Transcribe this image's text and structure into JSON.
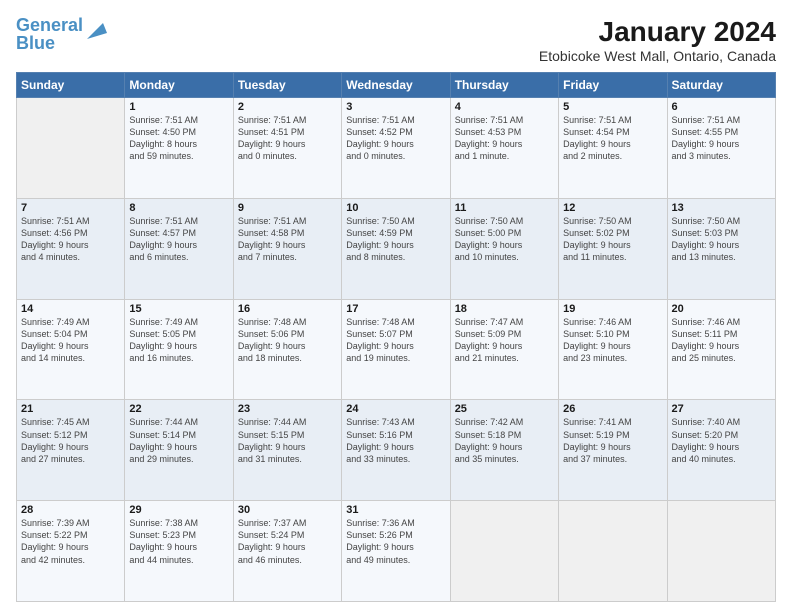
{
  "header": {
    "logo_line1": "General",
    "logo_line2": "Blue",
    "title": "January 2024",
    "subtitle": "Etobicoke West Mall, Ontario, Canada"
  },
  "weekdays": [
    "Sunday",
    "Monday",
    "Tuesday",
    "Wednesday",
    "Thursday",
    "Friday",
    "Saturday"
  ],
  "weeks": [
    [
      {
        "day": "",
        "text": ""
      },
      {
        "day": "1",
        "text": "Sunrise: 7:51 AM\nSunset: 4:50 PM\nDaylight: 8 hours\nand 59 minutes."
      },
      {
        "day": "2",
        "text": "Sunrise: 7:51 AM\nSunset: 4:51 PM\nDaylight: 9 hours\nand 0 minutes."
      },
      {
        "day": "3",
        "text": "Sunrise: 7:51 AM\nSunset: 4:52 PM\nDaylight: 9 hours\nand 0 minutes."
      },
      {
        "day": "4",
        "text": "Sunrise: 7:51 AM\nSunset: 4:53 PM\nDaylight: 9 hours\nand 1 minute."
      },
      {
        "day": "5",
        "text": "Sunrise: 7:51 AM\nSunset: 4:54 PM\nDaylight: 9 hours\nand 2 minutes."
      },
      {
        "day": "6",
        "text": "Sunrise: 7:51 AM\nSunset: 4:55 PM\nDaylight: 9 hours\nand 3 minutes."
      }
    ],
    [
      {
        "day": "7",
        "text": "Sunrise: 7:51 AM\nSunset: 4:56 PM\nDaylight: 9 hours\nand 4 minutes."
      },
      {
        "day": "8",
        "text": "Sunrise: 7:51 AM\nSunset: 4:57 PM\nDaylight: 9 hours\nand 6 minutes."
      },
      {
        "day": "9",
        "text": "Sunrise: 7:51 AM\nSunset: 4:58 PM\nDaylight: 9 hours\nand 7 minutes."
      },
      {
        "day": "10",
        "text": "Sunrise: 7:50 AM\nSunset: 4:59 PM\nDaylight: 9 hours\nand 8 minutes."
      },
      {
        "day": "11",
        "text": "Sunrise: 7:50 AM\nSunset: 5:00 PM\nDaylight: 9 hours\nand 10 minutes."
      },
      {
        "day": "12",
        "text": "Sunrise: 7:50 AM\nSunset: 5:02 PM\nDaylight: 9 hours\nand 11 minutes."
      },
      {
        "day": "13",
        "text": "Sunrise: 7:50 AM\nSunset: 5:03 PM\nDaylight: 9 hours\nand 13 minutes."
      }
    ],
    [
      {
        "day": "14",
        "text": "Sunrise: 7:49 AM\nSunset: 5:04 PM\nDaylight: 9 hours\nand 14 minutes."
      },
      {
        "day": "15",
        "text": "Sunrise: 7:49 AM\nSunset: 5:05 PM\nDaylight: 9 hours\nand 16 minutes."
      },
      {
        "day": "16",
        "text": "Sunrise: 7:48 AM\nSunset: 5:06 PM\nDaylight: 9 hours\nand 18 minutes."
      },
      {
        "day": "17",
        "text": "Sunrise: 7:48 AM\nSunset: 5:07 PM\nDaylight: 9 hours\nand 19 minutes."
      },
      {
        "day": "18",
        "text": "Sunrise: 7:47 AM\nSunset: 5:09 PM\nDaylight: 9 hours\nand 21 minutes."
      },
      {
        "day": "19",
        "text": "Sunrise: 7:46 AM\nSunset: 5:10 PM\nDaylight: 9 hours\nand 23 minutes."
      },
      {
        "day": "20",
        "text": "Sunrise: 7:46 AM\nSunset: 5:11 PM\nDaylight: 9 hours\nand 25 minutes."
      }
    ],
    [
      {
        "day": "21",
        "text": "Sunrise: 7:45 AM\nSunset: 5:12 PM\nDaylight: 9 hours\nand 27 minutes."
      },
      {
        "day": "22",
        "text": "Sunrise: 7:44 AM\nSunset: 5:14 PM\nDaylight: 9 hours\nand 29 minutes."
      },
      {
        "day": "23",
        "text": "Sunrise: 7:44 AM\nSunset: 5:15 PM\nDaylight: 9 hours\nand 31 minutes."
      },
      {
        "day": "24",
        "text": "Sunrise: 7:43 AM\nSunset: 5:16 PM\nDaylight: 9 hours\nand 33 minutes."
      },
      {
        "day": "25",
        "text": "Sunrise: 7:42 AM\nSunset: 5:18 PM\nDaylight: 9 hours\nand 35 minutes."
      },
      {
        "day": "26",
        "text": "Sunrise: 7:41 AM\nSunset: 5:19 PM\nDaylight: 9 hours\nand 37 minutes."
      },
      {
        "day": "27",
        "text": "Sunrise: 7:40 AM\nSunset: 5:20 PM\nDaylight: 9 hours\nand 40 minutes."
      }
    ],
    [
      {
        "day": "28",
        "text": "Sunrise: 7:39 AM\nSunset: 5:22 PM\nDaylight: 9 hours\nand 42 minutes."
      },
      {
        "day": "29",
        "text": "Sunrise: 7:38 AM\nSunset: 5:23 PM\nDaylight: 9 hours\nand 44 minutes."
      },
      {
        "day": "30",
        "text": "Sunrise: 7:37 AM\nSunset: 5:24 PM\nDaylight: 9 hours\nand 46 minutes."
      },
      {
        "day": "31",
        "text": "Sunrise: 7:36 AM\nSunset: 5:26 PM\nDaylight: 9 hours\nand 49 minutes."
      },
      {
        "day": "",
        "text": ""
      },
      {
        "day": "",
        "text": ""
      },
      {
        "day": "",
        "text": ""
      }
    ]
  ]
}
